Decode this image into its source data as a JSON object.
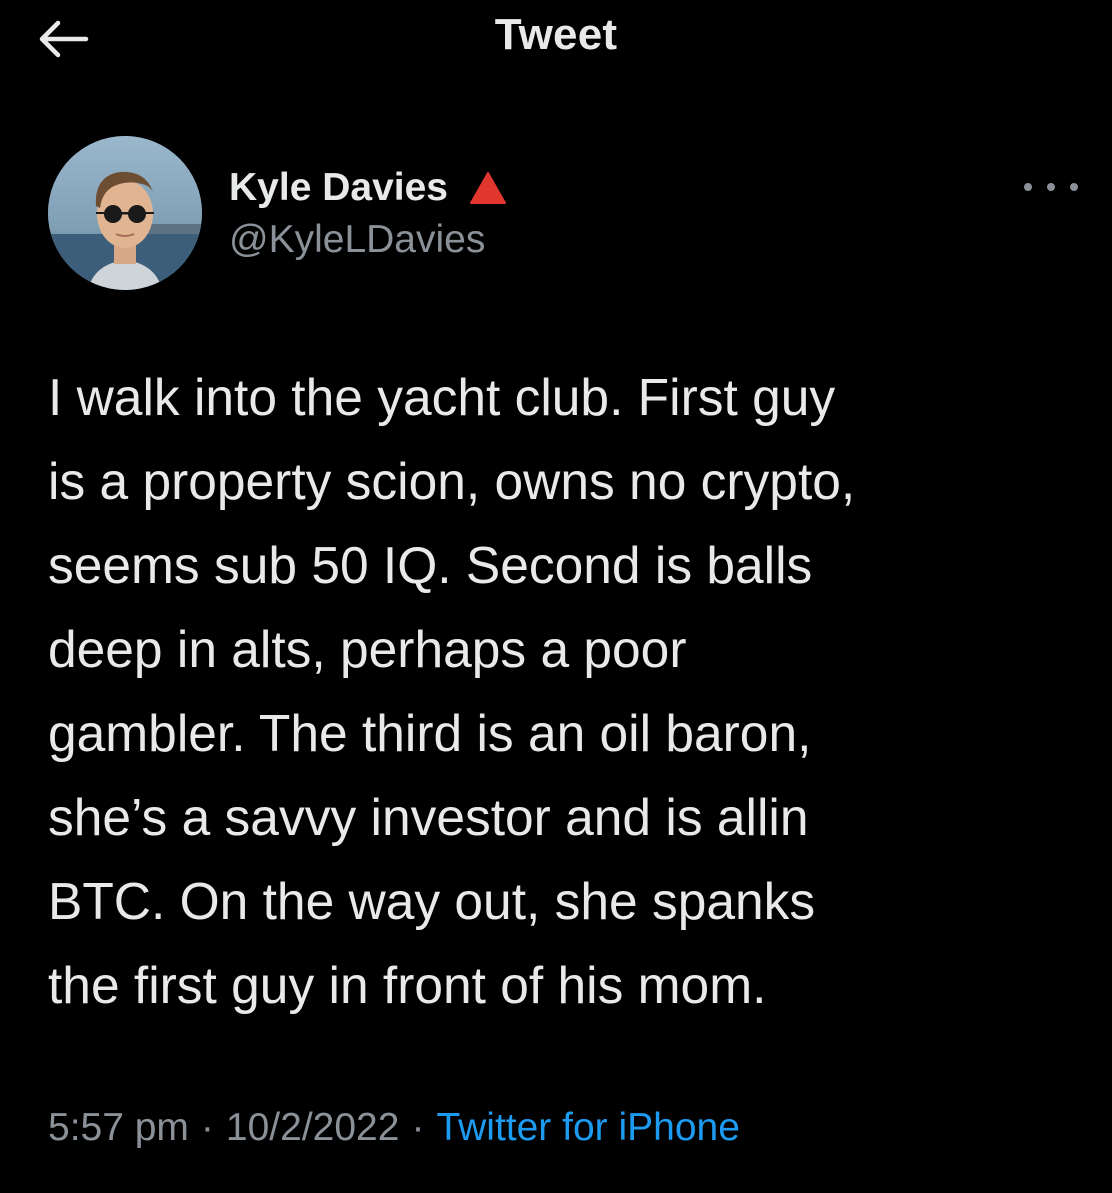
{
  "header": {
    "title": "Tweet",
    "back_icon": "arrow-left-icon"
  },
  "author": {
    "display_name": "Kyle Davies",
    "handle": "@KyleLDavies",
    "badge_icon": "red-triangle-icon",
    "badge_color": "#e0362e"
  },
  "more_icon": "ellipsis-horizontal-icon",
  "tweet": {
    "lines": [
      "I walk into the yacht club. First guy",
      "is a property scion, owns no crypto,",
      "seems sub 50 IQ. Second is balls",
      "deep in alts, perhaps a poor",
      "gambler. The third is an oil baron,",
      "she’s a savvy investor and is allin",
      "BTC. On the way out, she spanks",
      "the first guy in front of his mom."
    ]
  },
  "meta": {
    "time": "5:57 pm",
    "separator": "·",
    "date": "10/2/2022",
    "source": "Twitter for iPhone"
  },
  "colors": {
    "background": "#000000",
    "primary_text": "#e7e9ea",
    "secondary_text": "#8b9198",
    "link": "#1d9bf0"
  }
}
